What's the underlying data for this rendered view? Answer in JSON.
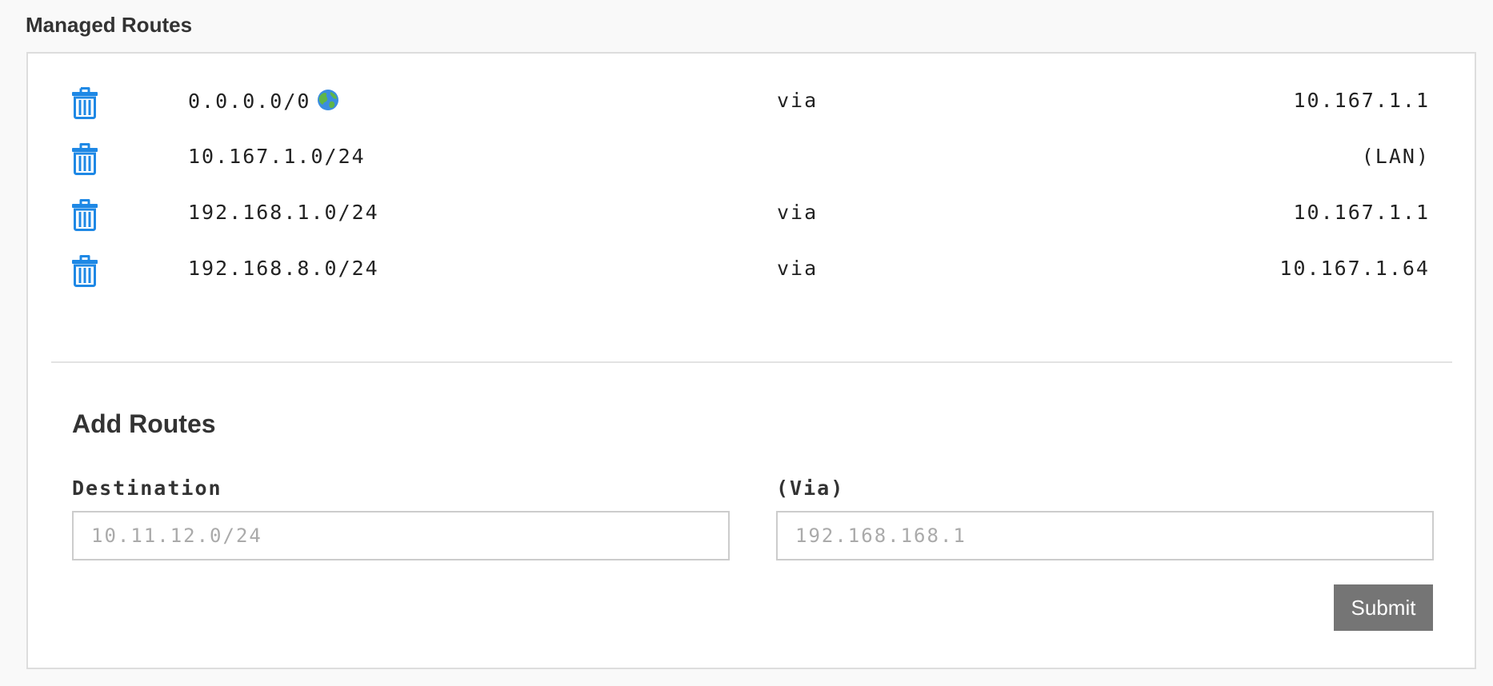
{
  "section_title": "Managed Routes",
  "colors": {
    "trash_icon": "#1e88e5",
    "submit_bg": "#757575",
    "panel_border": "#dddddd",
    "page_bg": "#f9f9f9"
  },
  "routes": [
    {
      "destination": "0.0.0.0/0",
      "has_globe_icon": true,
      "via": "via",
      "gateway": "10.167.1.1"
    },
    {
      "destination": "10.167.1.0/24",
      "has_globe_icon": false,
      "via": "",
      "gateway": "(LAN)"
    },
    {
      "destination": "192.168.1.0/24",
      "has_globe_icon": false,
      "via": "via",
      "gateway": "10.167.1.1"
    },
    {
      "destination": "192.168.8.0/24",
      "has_globe_icon": false,
      "via": "via",
      "gateway": "10.167.1.64"
    }
  ],
  "add_routes": {
    "title": "Add Routes",
    "destination": {
      "label": "Destination",
      "value": "",
      "placeholder": "10.11.12.0/24"
    },
    "via": {
      "label": "(Via)",
      "value": "",
      "placeholder": "192.168.168.1"
    },
    "submit_label": "Submit"
  }
}
